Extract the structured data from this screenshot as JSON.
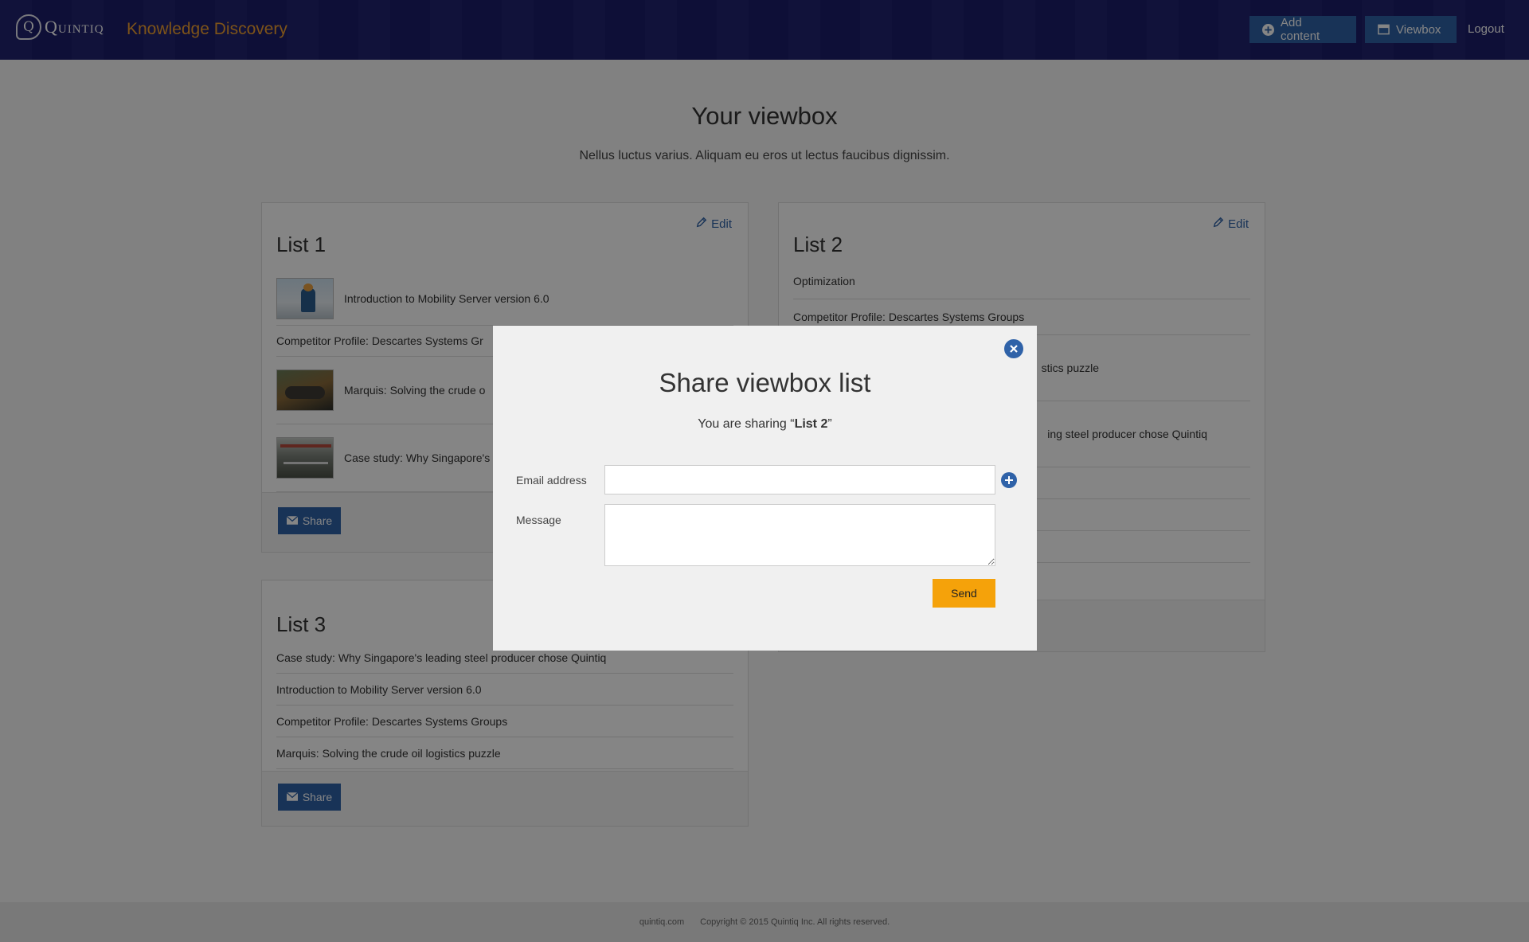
{
  "header": {
    "logo_text": "Quintiq",
    "app_title": "Knowledge Discovery",
    "add_content_label": "Add content",
    "viewbox_label": "Viewbox",
    "logout_label": "Logout"
  },
  "page": {
    "title": "Your viewbox",
    "subtitle": "Nellus luctus varius. Aliquam eu eros ut lectus faucibus dignissim."
  },
  "lists": [
    {
      "title": "List 1",
      "edit_label": "Edit",
      "share_label": "Share",
      "items": [
        "Introduction to Mobility Server version 6.0",
        "Competitor Profile: Descartes Systems Gr",
        "Marquis: Solving the crude o",
        "Case study: Why Singapore's"
      ]
    },
    {
      "title": "List 2",
      "edit_label": "Edit",
      "items": [
        "Optimization",
        "Competitor Profile: Descartes Systems Groups",
        "stics puzzle",
        "ing steel producer chose Quintiq"
      ]
    },
    {
      "title": "List 3",
      "share_label": "Share",
      "items": [
        "Case study: Why Singapore's leading steel producer chose Quintiq",
        "Introduction to Mobility Server version 6.0",
        "Competitor Profile: Descartes Systems Groups",
        "Marquis: Solving the crude oil logistics puzzle"
      ]
    }
  ],
  "modal": {
    "title": "Share viewbox list",
    "sub_prefix": "You are sharing “",
    "sub_list": "List 2",
    "sub_suffix": "”",
    "email_label": "Email address",
    "email_value": "",
    "message_label": "Message",
    "message_value": "",
    "send_label": "Send"
  },
  "footer": {
    "site": "quintiq.com",
    "copyright": "Copyright © 2015 Quintiq Inc. All rights reserved."
  },
  "colors": {
    "header_bg": "#1b1d6a",
    "accent": "#2f62a8",
    "brand_orange": "#f0a030",
    "send": "#f5a20a"
  }
}
